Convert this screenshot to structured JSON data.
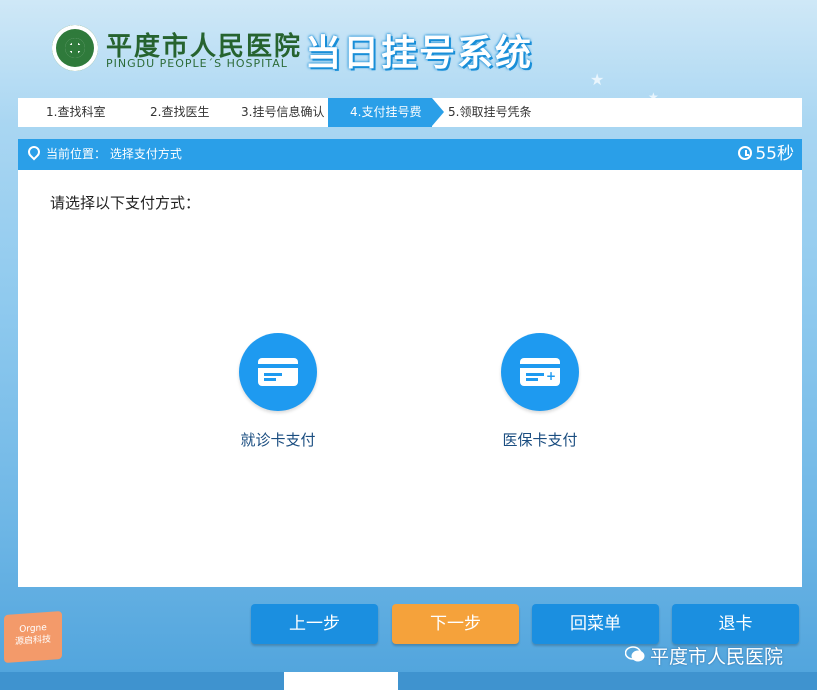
{
  "header": {
    "hospital_cn": "平度市人民医院",
    "hospital_en": "PINGDU PEOPLE´S HOSPITAL",
    "system_title": "当日挂号系统"
  },
  "steps": [
    {
      "label": "1.查找科室",
      "active": false
    },
    {
      "label": "2.查找医生",
      "active": false
    },
    {
      "label": "3.挂号信息确认",
      "active": false
    },
    {
      "label": "4.支付挂号费",
      "active": true
    },
    {
      "label": "5.领取挂号凭条",
      "active": false
    }
  ],
  "location": {
    "text": "当前位置：  选择支付方式",
    "timer": "55秒"
  },
  "main": {
    "prompt": "请选择以下支付方式：",
    "options": [
      {
        "label": "就诊卡支付",
        "icon": "card-icon"
      },
      {
        "label": "医保卡支付",
        "icon": "card-plus-icon"
      }
    ]
  },
  "buttons": {
    "prev": "上一步",
    "next": "下一步",
    "menu": "回菜单",
    "eject": "退卡"
  },
  "brand": {
    "line1": "Orgne",
    "line2": "源启科技"
  },
  "watermark": "平度市人民医院",
  "colors": {
    "accent": "#2a9fe8",
    "button_blue": "#1b8fe0",
    "button_orange": "#f5a23b"
  }
}
